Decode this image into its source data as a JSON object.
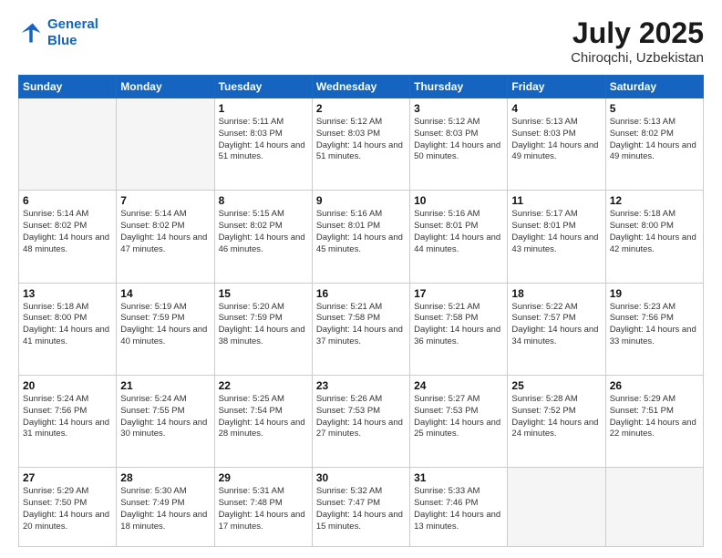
{
  "logo": {
    "line1": "General",
    "line2": "Blue"
  },
  "title": "July 2025",
  "location": "Chiroqchi, Uzbekistan",
  "weekdays": [
    "Sunday",
    "Monday",
    "Tuesday",
    "Wednesday",
    "Thursday",
    "Friday",
    "Saturday"
  ],
  "weeks": [
    [
      {
        "day": "",
        "info": ""
      },
      {
        "day": "",
        "info": ""
      },
      {
        "day": "1",
        "info": "Sunrise: 5:11 AM\nSunset: 8:03 PM\nDaylight: 14 hours\nand 51 minutes."
      },
      {
        "day": "2",
        "info": "Sunrise: 5:12 AM\nSunset: 8:03 PM\nDaylight: 14 hours\nand 51 minutes."
      },
      {
        "day": "3",
        "info": "Sunrise: 5:12 AM\nSunset: 8:03 PM\nDaylight: 14 hours\nand 50 minutes."
      },
      {
        "day": "4",
        "info": "Sunrise: 5:13 AM\nSunset: 8:03 PM\nDaylight: 14 hours\nand 49 minutes."
      },
      {
        "day": "5",
        "info": "Sunrise: 5:13 AM\nSunset: 8:02 PM\nDaylight: 14 hours\nand 49 minutes."
      }
    ],
    [
      {
        "day": "6",
        "info": "Sunrise: 5:14 AM\nSunset: 8:02 PM\nDaylight: 14 hours\nand 48 minutes."
      },
      {
        "day": "7",
        "info": "Sunrise: 5:14 AM\nSunset: 8:02 PM\nDaylight: 14 hours\nand 47 minutes."
      },
      {
        "day": "8",
        "info": "Sunrise: 5:15 AM\nSunset: 8:02 PM\nDaylight: 14 hours\nand 46 minutes."
      },
      {
        "day": "9",
        "info": "Sunrise: 5:16 AM\nSunset: 8:01 PM\nDaylight: 14 hours\nand 45 minutes."
      },
      {
        "day": "10",
        "info": "Sunrise: 5:16 AM\nSunset: 8:01 PM\nDaylight: 14 hours\nand 44 minutes."
      },
      {
        "day": "11",
        "info": "Sunrise: 5:17 AM\nSunset: 8:01 PM\nDaylight: 14 hours\nand 43 minutes."
      },
      {
        "day": "12",
        "info": "Sunrise: 5:18 AM\nSunset: 8:00 PM\nDaylight: 14 hours\nand 42 minutes."
      }
    ],
    [
      {
        "day": "13",
        "info": "Sunrise: 5:18 AM\nSunset: 8:00 PM\nDaylight: 14 hours\nand 41 minutes."
      },
      {
        "day": "14",
        "info": "Sunrise: 5:19 AM\nSunset: 7:59 PM\nDaylight: 14 hours\nand 40 minutes."
      },
      {
        "day": "15",
        "info": "Sunrise: 5:20 AM\nSunset: 7:59 PM\nDaylight: 14 hours\nand 38 minutes."
      },
      {
        "day": "16",
        "info": "Sunrise: 5:21 AM\nSunset: 7:58 PM\nDaylight: 14 hours\nand 37 minutes."
      },
      {
        "day": "17",
        "info": "Sunrise: 5:21 AM\nSunset: 7:58 PM\nDaylight: 14 hours\nand 36 minutes."
      },
      {
        "day": "18",
        "info": "Sunrise: 5:22 AM\nSunset: 7:57 PM\nDaylight: 14 hours\nand 34 minutes."
      },
      {
        "day": "19",
        "info": "Sunrise: 5:23 AM\nSunset: 7:56 PM\nDaylight: 14 hours\nand 33 minutes."
      }
    ],
    [
      {
        "day": "20",
        "info": "Sunrise: 5:24 AM\nSunset: 7:56 PM\nDaylight: 14 hours\nand 31 minutes."
      },
      {
        "day": "21",
        "info": "Sunrise: 5:24 AM\nSunset: 7:55 PM\nDaylight: 14 hours\nand 30 minutes."
      },
      {
        "day": "22",
        "info": "Sunrise: 5:25 AM\nSunset: 7:54 PM\nDaylight: 14 hours\nand 28 minutes."
      },
      {
        "day": "23",
        "info": "Sunrise: 5:26 AM\nSunset: 7:53 PM\nDaylight: 14 hours\nand 27 minutes."
      },
      {
        "day": "24",
        "info": "Sunrise: 5:27 AM\nSunset: 7:53 PM\nDaylight: 14 hours\nand 25 minutes."
      },
      {
        "day": "25",
        "info": "Sunrise: 5:28 AM\nSunset: 7:52 PM\nDaylight: 14 hours\nand 24 minutes."
      },
      {
        "day": "26",
        "info": "Sunrise: 5:29 AM\nSunset: 7:51 PM\nDaylight: 14 hours\nand 22 minutes."
      }
    ],
    [
      {
        "day": "27",
        "info": "Sunrise: 5:29 AM\nSunset: 7:50 PM\nDaylight: 14 hours\nand 20 minutes."
      },
      {
        "day": "28",
        "info": "Sunrise: 5:30 AM\nSunset: 7:49 PM\nDaylight: 14 hours\nand 18 minutes."
      },
      {
        "day": "29",
        "info": "Sunrise: 5:31 AM\nSunset: 7:48 PM\nDaylight: 14 hours\nand 17 minutes."
      },
      {
        "day": "30",
        "info": "Sunrise: 5:32 AM\nSunset: 7:47 PM\nDaylight: 14 hours\nand 15 minutes."
      },
      {
        "day": "31",
        "info": "Sunrise: 5:33 AM\nSunset: 7:46 PM\nDaylight: 14 hours\nand 13 minutes."
      },
      {
        "day": "",
        "info": ""
      },
      {
        "day": "",
        "info": ""
      }
    ]
  ]
}
